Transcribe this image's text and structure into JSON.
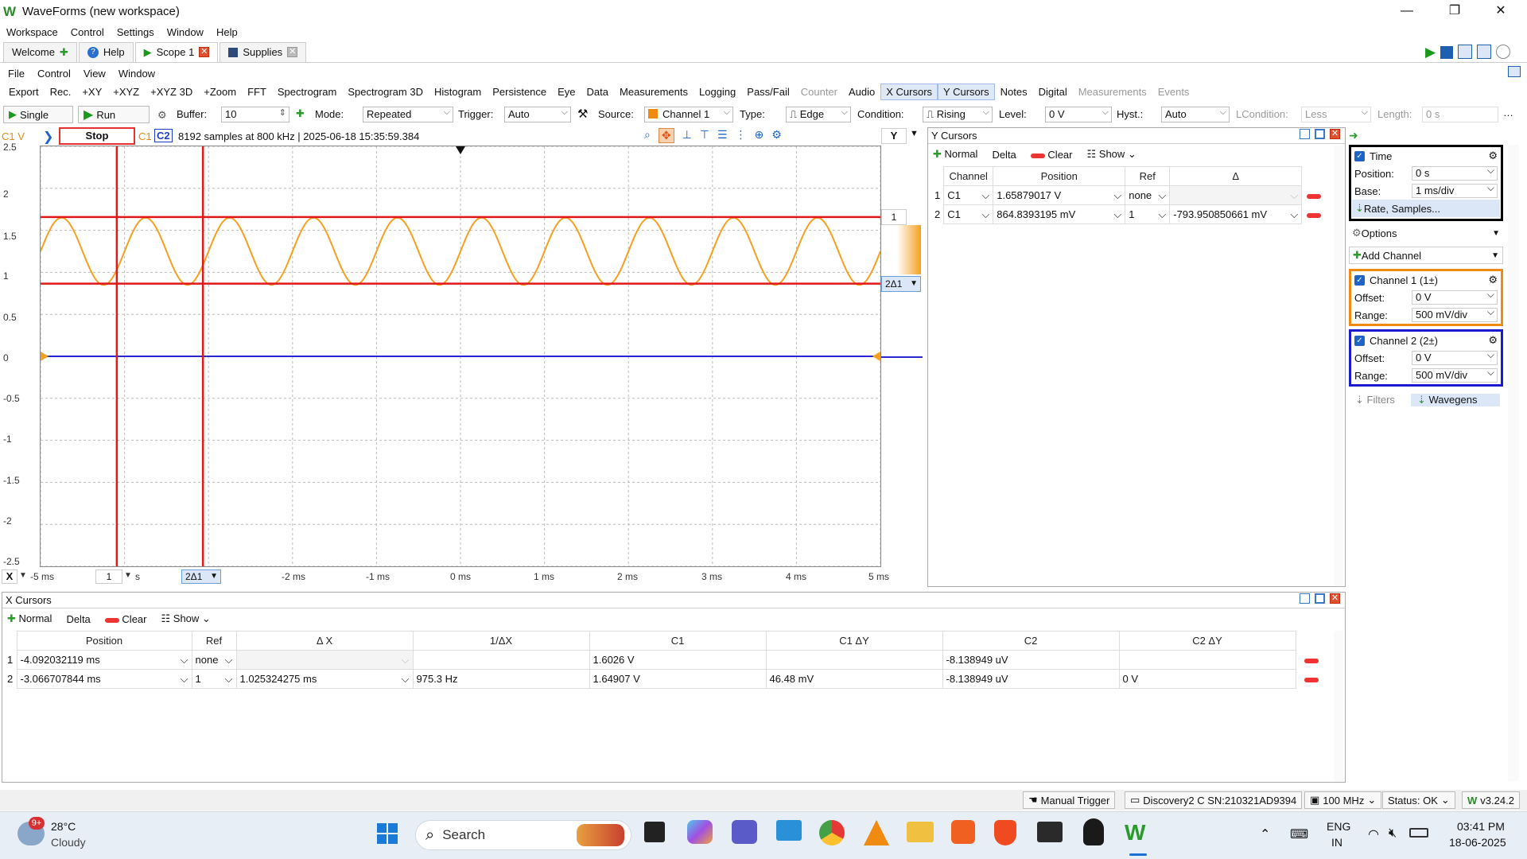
{
  "window": {
    "title": "WaveForms (new workspace)"
  },
  "menubar": [
    "Workspace",
    "Control",
    "Settings",
    "Window",
    "Help"
  ],
  "tabs": [
    {
      "label": "Welcome",
      "icon": "plus-icon"
    },
    {
      "label": "Help",
      "icon": "help-icon"
    },
    {
      "label": "Scope 1",
      "icon": "play-icon"
    },
    {
      "label": "Supplies",
      "icon": "supplies-icon"
    }
  ],
  "submenu": [
    "File",
    "Control",
    "View",
    "Window"
  ],
  "toolmenu": [
    "Export",
    "Rec.",
    "+XY",
    "+XYZ",
    "+XYZ 3D",
    "+Zoom",
    "FFT",
    "Spectrogram",
    "Spectrogram 3D",
    "Histogram",
    "Persistence",
    "Eye",
    "Data",
    "Measurements",
    "Logging",
    "Pass/Fail",
    "Counter",
    "Audio",
    "X Cursors",
    "Y Cursors",
    "Notes",
    "Digital",
    "Measurements",
    "Events"
  ],
  "controls": {
    "single": "Single",
    "run": "Run",
    "buffer_label": "Buffer:",
    "buffer_value": "10",
    "mode_label": "Mode:",
    "mode_value": "Repeated",
    "trigger_label": "Trigger:",
    "trigger_value": "Auto",
    "source_label": "Source:",
    "source_value": "Channel 1",
    "type_label": "Type:",
    "type_value": "Edge",
    "condition_label": "Condition:",
    "condition_value": "Rising",
    "level_label": "Level:",
    "level_value": "0 V",
    "hyst_label": "Hyst.:",
    "hyst_value": "Auto",
    "lcondition_label": "LCondition:",
    "lcondition_value": "Less",
    "length_label": "Length:",
    "length_value": "0 s"
  },
  "scope": {
    "c1v": "C1 V",
    "state": "Stop",
    "c1": "C1",
    "c2": "C2",
    "info": "8192 samples at 800 kHz  | 2025-06-18 15:35:59.384",
    "y_btn": "Y",
    "cursor_index": "1",
    "delta_label": "2Δ1",
    "x_label": "X",
    "x_index": "1",
    "x_unit": "s",
    "y_ticks": [
      "2.5",
      "2",
      "1.5",
      "1",
      "0.5",
      "0",
      "-0.5",
      "-1",
      "-1.5",
      "-2",
      "-2.5"
    ],
    "x_ticks": [
      "-5 ms",
      "-4 ms",
      "-3 ms",
      "-2 ms",
      "-1 ms",
      "0 ms",
      "1 ms",
      "2 ms",
      "3 ms",
      "4 ms",
      "5 ms"
    ]
  },
  "chart_data": {
    "type": "line",
    "x_range_ms": [
      -5,
      5
    ],
    "y_range_v": [
      -2.5,
      2.5
    ],
    "grid": true,
    "series": [
      {
        "name": "C1",
        "color": "#f5a020",
        "offset_v": 1.25,
        "amplitude_v": 0.4,
        "frequency_khz": 1.0
      },
      {
        "name": "C2",
        "color": "#2828d0",
        "offset_v": 0,
        "amplitude_v": 0,
        "frequency_khz": 0
      }
    ],
    "y_cursors_v": [
      1.65879017,
      0.8648393195
    ],
    "x_cursors_ms": [
      -4.092032119,
      -3.066707844
    ]
  },
  "ycursors": {
    "title": "Y Cursors",
    "normal": "Normal",
    "delta": "Delta",
    "clear": "Clear",
    "show": "Show",
    "headers": [
      "Channel",
      "Position",
      "Ref",
      "Δ"
    ],
    "rows": [
      {
        "idx": "1",
        "channel": "C1",
        "position": "1.65879017 V",
        "ref": "none",
        "delta": ""
      },
      {
        "idx": "2",
        "channel": "C1",
        "position": "864.8393195 mV",
        "ref": "1",
        "delta": "-793.950850661 mV"
      }
    ]
  },
  "rightpanel": {
    "time": "Time",
    "position_label": "Position:",
    "position_value": "0 s",
    "base_label": "Base:",
    "base_value": "1 ms/div",
    "rate": "Rate, Samples...",
    "options": "Options",
    "add_channel": "Add Channel",
    "ch1": "Channel 1 (1±)",
    "ch1_offset_label": "Offset:",
    "ch1_offset": "0 V",
    "ch1_range_label": "Range:",
    "ch1_range": "500 mV/div",
    "ch2": "Channel 2 (2±)",
    "ch2_offset_label": "Offset:",
    "ch2_offset": "0 V",
    "ch2_range_label": "Range:",
    "ch2_range": "500 mV/div",
    "filters": "Filters",
    "wavegens": "Wavegens"
  },
  "xcursors": {
    "title": "X Cursors",
    "normal": "Normal",
    "delta": "Delta",
    "clear": "Clear",
    "show": "Show",
    "headers": [
      "Position",
      "Ref",
      "Δ X",
      "1/ΔX",
      "C1",
      "C1 ΔY",
      "C2",
      "C2 ΔY"
    ],
    "rows": [
      {
        "idx": "1",
        "position": "-4.092032119 ms",
        "ref": "none",
        "dx": "",
        "inv": "",
        "c1": "1.6026 V",
        "c1dy": "",
        "c2": "-8.138949 uV",
        "c2dy": ""
      },
      {
        "idx": "2",
        "position": "-3.066707844 ms",
        "ref": "1",
        "dx": "1.025324275 ms",
        "inv": "975.3 Hz",
        "c1": "1.64907 V",
        "c1dy": "46.48 mV",
        "c2": "-8.138949 uV",
        "c2dy": "0 V"
      }
    ]
  },
  "statusbar": {
    "manual_trigger": "Manual Trigger",
    "device": "Discovery2 C SN:210321AD9394",
    "freq": "100 MHz",
    "status": "Status: OK",
    "version": "v3.24.2"
  },
  "taskbar": {
    "weather_temp": "28°C",
    "weather_desc": "Cloudy",
    "weather_badge": "9+",
    "search": "Search",
    "lang1": "ENG",
    "lang2": "IN",
    "time": "03:41 PM",
    "date": "18-06-2025"
  }
}
